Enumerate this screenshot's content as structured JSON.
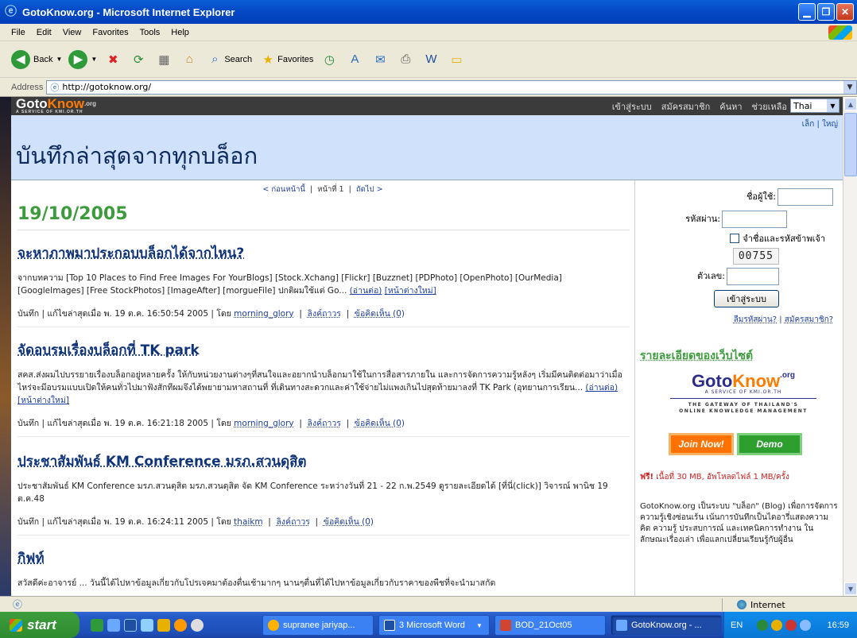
{
  "window": {
    "title": "GotoKnow.org - Microsoft Internet Explorer"
  },
  "menu": [
    "File",
    "Edit",
    "View",
    "Favorites",
    "Tools",
    "Help"
  ],
  "toolbar": {
    "back": "Back",
    "search": "Search",
    "favorites": "Favorites"
  },
  "address": {
    "label": "Address",
    "url": "http://gotoknow.org/"
  },
  "site": {
    "logo_goto": "Goto",
    "logo_know": "Know",
    "logo_org": ".org",
    "logo_sub": "A SERVICE OF KMI.OR.TH",
    "nav": [
      "เข้าสู่ระบบ",
      "สมัครสมาชิก",
      "ค้นหา",
      "ช่วยเหลือ"
    ],
    "language": "Thai",
    "size_links": "เล็ก | ใหญ่",
    "heading": "บันทึกล่าสุดจากทุกบล็อก"
  },
  "pager": {
    "prev": "< ก่อนหน้านี้",
    "page": "หน้าที่ 1",
    "next": "ถัดไป >"
  },
  "date": "19/10/2005",
  "posts": [
    {
      "title": "จะหาภาพมาประกอบบล็อกได้จากไหน?",
      "body": "จากบทความ [Top 10 Places to Find Free Images For YourBlogs] [Stock.Xchang] [Flickr]   [Buzznet]   [PDPhoto]   [OpenPhoto] [OurMedia]   [GoogleImages]   [Free StockPhotos]   [ImageAfter]   [morgueFile]  ปกติผมใช้แต่ Go...",
      "more": "(อ่านต่อ)",
      "newwin": "[หน้าต่างใหม่]",
      "meta_prefix": "บันทึก  |  แก้ไขล่าสุดเมื่อ พ. 19 ต.ค. 16:50:54 2005  |  โดย",
      "author": "morning_glory",
      "link": "ลิงค์ถาวร",
      "comments": "ข้อคิดเห็น (0)"
    },
    {
      "title": "จัดอบรมเรื่องบล็อกที่ TK park",
      "body": "สคส.ส่งผมไปบรรยายเรื่องบล็อกอยู่หลายครั้ง ให้กับหน่วยงานต่างๆที่สนใจและอยากนำบล็อกมาใช้ในการสื่อสารภายใน และการจัดการความรู้หลังๆ เริ่มมีคนติดต่อมาว่าเมื่อไหร่จะมีอบรมแบบเปิดให้คนทั่วไปมาฟังสักทีผมจึงได้พยายามหาสถานที่ ที่เดินทางสะดวกและค่าใช้จ่ายไม่แพงเกินไปสุดท้ายมาลงที่ TK Park (อุทยานการเรียน...",
      "more": "(อ่านต่อ)",
      "newwin": "[หน้าต่างใหม่]",
      "meta_prefix": "บันทึก  |  แก้ไขล่าสุดเมื่อ พ. 19 ต.ค. 16:21:18 2005  |  โดย",
      "author": "morning_glory",
      "link": "ลิงค์ถาวร",
      "comments": "ข้อคิดเห็น (0)"
    },
    {
      "title": "ประชาสัมพันธ์ KM Conference มรภ.สวนดุสิต",
      "body": "ประชาสัมพันธ์ KM Conference มรภ.สวนดุสิต          มรภ.สวนดุสิต จัด KM Conference  ระหว่างวันที่ 21 - 22 ก.พ.2549   ดูรายละเอียดได้ [ที่นี่(click)] วิจารณ์ พานิช 19 ต.ค.48",
      "more": "",
      "newwin": "",
      "meta_prefix": "บันทึก  |  แก้ไขล่าสุดเมื่อ พ. 19 ต.ค. 16:24:11 2005  |  โดย",
      "author": "thaikm",
      "link": "ลิงค์ถาวร",
      "comments": "ข้อคิดเห็น (0)"
    },
    {
      "title": "กิฟท์",
      "body": "สวัสดีค่ะอาจารย์ ...    วันนี้ได้ไปหาข้อมูลเกี่ยวกับโปรเจคมาต้องตื่นเช้ามากๆ นานๆตื่นที่ได้ไปหาข้อมูลเกี่ยวกับราคาของพืชที่จะนำมาสกัด",
      "more": "",
      "newwin": "",
      "meta_prefix": "",
      "author": "",
      "link": "",
      "comments": ""
    }
  ],
  "login": {
    "user_label": "ชื่อผู้ใช้:",
    "pass_label": "รหัสผ่าน:",
    "remember": "จำชื่อและรหัสข้าพเจ้า",
    "captcha": "00755",
    "code_label": "ตัวเลข:",
    "submit": "เข้าสู่ระบบ",
    "forgot": "ลืมรหัสผ่าน?",
    "signup": "สมัครสมาชิก?"
  },
  "sidebar": {
    "heading": "รายละเอียดของเว็บไซต์",
    "logo_goto": "Goto",
    "logo_know": "Know",
    "logo_org": ".org",
    "logo_sub": "A SERVICE OF KMI.OR.TH",
    "gateway1": "THE GATEWAY OF THAILAND'S",
    "gateway2": "ONLINE KNOWLEDGE MANAGEMENT",
    "join": "Join Now!",
    "demo": "Demo",
    "free_prefix": "ฟรี!",
    "free_text": " เนื้อที่ 30 MB, อัพโหลดไฟล์ 1 MB/ครั้ง",
    "desc": "GotoKnow.org เป็นระบบ \"บล็อก\" (Blog) เพื่อการจัดการความรู้เชิงซ่อนเร้น เน้นการบันทึกเป็นไดอารี่แสดงความคิด ความรู้ ประสบการณ์ และเทคนิคการทำงาน ในลักษณะเรื่องเล่า เพื่อแลกเปลี่ยนเรียนรู้กับผู้อื่น"
  },
  "status": {
    "zone": "Internet"
  },
  "taskbar": {
    "start": "start",
    "tasks": [
      "supranee jariyap...",
      "3 Microsoft Word",
      "BOD_21Oct05",
      "GotoKnow.org - ..."
    ],
    "lang": "EN",
    "clock": "16:59"
  }
}
